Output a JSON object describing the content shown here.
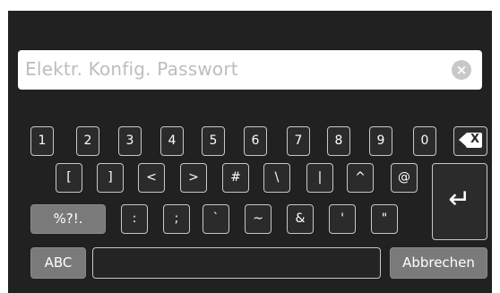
{
  "search": {
    "placeholder": "Elektr. Konfig. Passwort",
    "clear_icon": "×"
  },
  "keyboard": {
    "row1": [
      "1",
      "2",
      "3",
      "4",
      "5",
      "6",
      "7",
      "8",
      "9",
      "0"
    ],
    "row2": [
      "[",
      "]",
      "<",
      ">",
      "#",
      "\\",
      "|",
      "^",
      "@"
    ],
    "row3": [
      ":",
      ";",
      "`",
      "~",
      "&",
      "'",
      "\""
    ],
    "mode_symbols_label": "%?!.",
    "mode_abc_label": "ABC",
    "cancel_label": "Abbrechen",
    "backspace_icon_text": "X",
    "enter_icon_text": "↵"
  },
  "colors": {
    "panel": "#212121",
    "key_border": "#c7c7c7",
    "key_active_gray": "#7a7a7a",
    "search_bg": "#ffffff"
  }
}
